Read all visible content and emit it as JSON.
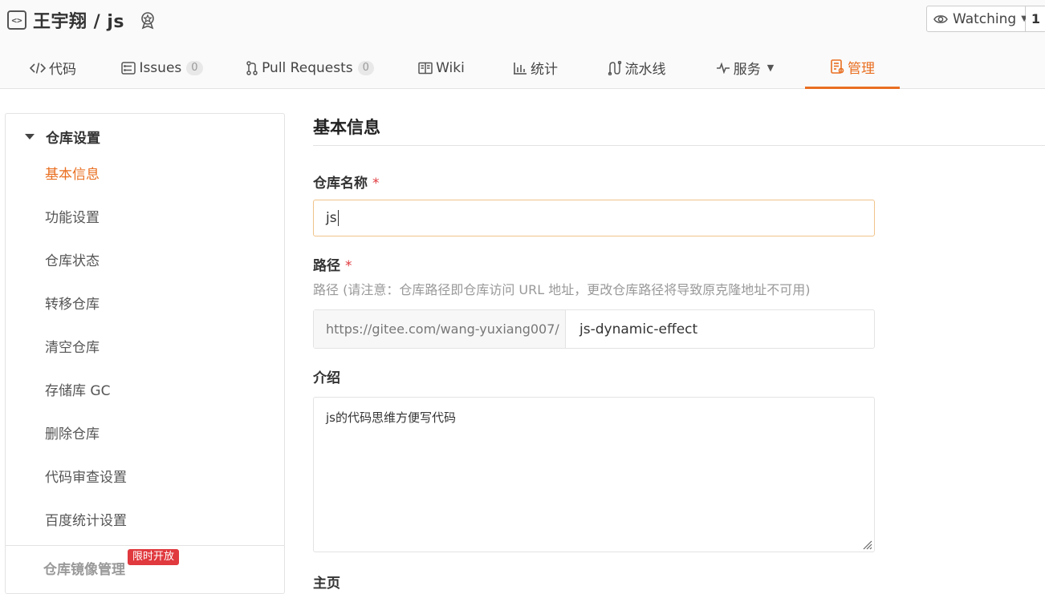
{
  "repo": {
    "title": "王宇翔 / js",
    "icon": "code-repo-icon",
    "badge_icon": "award-icon"
  },
  "watch": {
    "label": "Watching",
    "count": "1"
  },
  "tabs": [
    {
      "label": "代码",
      "icon": "code-icon",
      "count": ""
    },
    {
      "label": "Issues",
      "icon": "issues-icon",
      "count": "0"
    },
    {
      "label": "Pull Requests",
      "icon": "pull-request-icon",
      "count": "0"
    },
    {
      "label": "Wiki",
      "icon": "wiki-icon",
      "count": ""
    },
    {
      "label": "统计",
      "icon": "stats-icon",
      "count": ""
    },
    {
      "label": "流水线",
      "icon": "pipeline-icon",
      "count": ""
    },
    {
      "label": "服务",
      "icon": "pulse-icon",
      "count": ""
    },
    {
      "label": "管理",
      "icon": "manage-icon",
      "count": ""
    }
  ],
  "sidebar": {
    "section": "仓库设置",
    "items": [
      {
        "label": "基本信息"
      },
      {
        "label": "功能设置"
      },
      {
        "label": "仓库状态"
      },
      {
        "label": "转移仓库"
      },
      {
        "label": "清空仓库"
      },
      {
        "label": "存储库 GC"
      },
      {
        "label": "删除仓库"
      },
      {
        "label": "代码审查设置"
      },
      {
        "label": "百度统计设置"
      }
    ],
    "mirror_section": "仓库镜像管理",
    "limited_badge": "限时开放"
  },
  "main": {
    "title": "基本信息",
    "name_label": "仓库名称",
    "required_mark": "*",
    "name_value": "js",
    "path_label": "路径",
    "path_hint": "路径 (请注意：仓库路径即仓库访问 URL 地址，更改仓库路径将导致原克隆地址不可用)",
    "path_prefix": "https://gitee.com/wang-yuxiang007/",
    "path_value": "js-dynamic-effect",
    "desc_label": "介绍",
    "desc_value": "js的代码思维方便写代码",
    "home_label": "主页"
  },
  "colors": {
    "accent": "#e96f21",
    "required": "#e0393e",
    "badge_bg": "#e0393e"
  }
}
